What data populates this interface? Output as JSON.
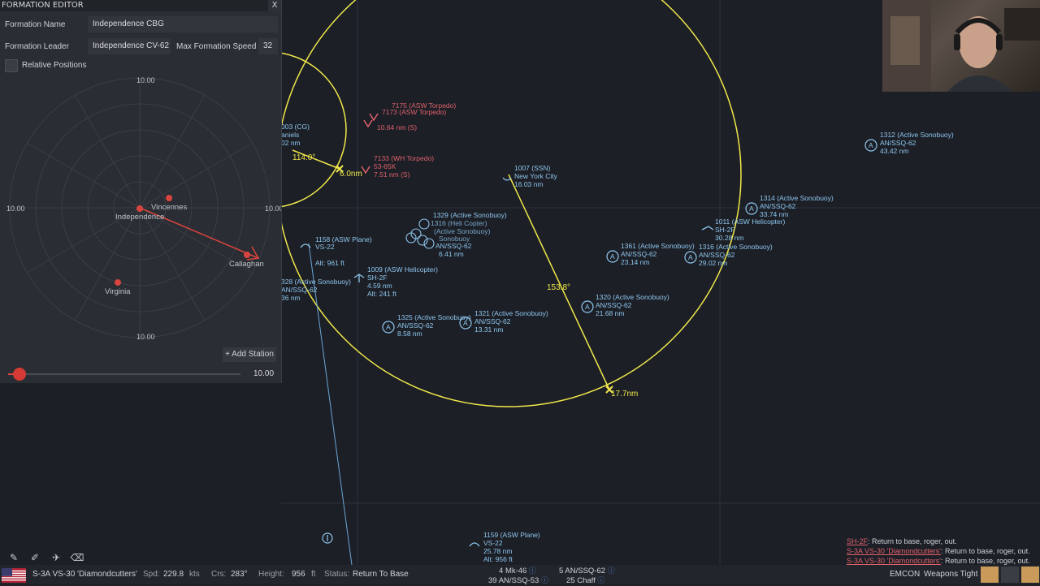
{
  "formation_editor": {
    "title": "FORMATION EDITOR",
    "close_label": "X",
    "name_label": "Formation Name",
    "name_value": "Independence CBG",
    "leader_label": "Formation Leader",
    "leader_value": "Independence CV-62",
    "speed_label": "Max Formation Speed",
    "speed_value": "32",
    "relative_label": "Relative Positions",
    "rings": {
      "top": "10.00",
      "left": "10.00",
      "right": "10.00",
      "bottom": "10.00"
    },
    "units": [
      {
        "name": "Independence"
      },
      {
        "name": "Vincennes"
      },
      {
        "name": "Callaghan"
      },
      {
        "name": "Virginia"
      }
    ],
    "add_station_label": "+ Add Station",
    "slider_value": "10.00",
    "slider_fraction": 0.05
  },
  "map": {
    "labels": {
      "cg1": "003 (CG)",
      "cg2": "aniels",
      "cg3": "02 nm",
      "bear114": "114.0°",
      "rng6": "6.0nm",
      "bear153": "153.8°",
      "rng17": "17.7nm",
      "t1a": "7133 (WH Torpedo)",
      "t1b": "53-65K",
      "t1c": "7.51 nm (S)",
      "t2a": "7175 (ASW Torpedo)",
      "t2b": "7173 (ASW Torpedo)",
      "t2c": "10.64 nm (S)",
      "ssn1": "1007 (SSN)",
      "ssn2": "New York City",
      "ssn3": "16.03 nm",
      "s1312a": "1312 (Active Sonobuoy)",
      "s1312b": "AN/SSQ-62",
      "s1312c": "43.42 nm",
      "s1314a": "1314 (Active Sonobuoy)",
      "s1314b": "AN/SSQ-62",
      "s1314c": "33.74 nm",
      "h1011a": "1011 (ASW Helicopter)",
      "h1011b": "SH-2F",
      "h1011c": "30.28 nm",
      "s1316a": "1316 (Active Sonobuoy)",
      "s1316b": "AN/SSQ-62",
      "s1316c": "29.02 nm",
      "s1361a": "1361 (Active Sonobuoy)",
      "s1361b": "AN/SSQ-62",
      "s1361c": "23.14 nm",
      "s1320a": "1320 (Active Sonobuoy)",
      "s1320b": "AN/SSQ-62",
      "s1320c": "21.68 nm",
      "s1321a": "1321 (Active Sonobuoy)",
      "s1321b": "AN/SSQ-62",
      "s1321c": "13.31 nm",
      "s1325a": "1325 (Active Sonobuoy)",
      "s1325b": "AN/SSQ-62",
      "s1325c": "8.58 nm",
      "h1009a": "1009 (ASW Helicopter)",
      "h1009b": "SH-2F",
      "h1009c": "4.59 nm",
      "h1009d": "Alt: 241 ft",
      "p1158a": "1158 (ASW Plane)",
      "p1158b": "VS-22",
      "p1158c": "Alt: 961 ft",
      "s1328a": "328 (Active Sonobuoy)",
      "s1328b": "AN/SSQ-62",
      "s1328c": "36 nm",
      "cl1": "1329 (Active Sonobuoy)",
      "cl2": "AN/SSQ-62",
      "cl3": "6.41 nm",
      "p1159a": "1159 (ASW Plane)",
      "p1159b": "VS-22",
      "p1159c": "25.78 nm",
      "p1159d": "Alt: 956 ft"
    }
  },
  "messages": [
    {
      "source": "SH-2F",
      "text": ": Return to base, roger, out."
    },
    {
      "source": "S-3A VS-30 'Diamondcutters'",
      "text": ": Return to base, roger, out."
    },
    {
      "source": "S-3A VS-30 'Diamondcutters'",
      "text": ": Return to base, roger, out."
    }
  ],
  "status_bar": {
    "unit_name": "S-3A VS-30 'Diamondcutters'",
    "speed_label": "Spd:",
    "speed_value": "229.8",
    "speed_unit": "kts",
    "course_label": "Crs:",
    "course_value": "283°",
    "height_label": "Height:",
    "height_value": "956",
    "height_unit": "ft",
    "status_label": "Status:",
    "status_value": "Return To Base",
    "weapons": [
      {
        "count": "4",
        "name": "Mk-46"
      },
      {
        "count": "5",
        "name": "AN/SSQ-62"
      },
      {
        "count": "39",
        "name": "AN/SSQ-53"
      },
      {
        "count": "25",
        "name": "Chaff"
      }
    ],
    "emcon_label": "EMCON",
    "weapons_state": "Weapons Tight"
  },
  "colors": {
    "range_ring": "#f0e84a",
    "friendly": "#8ec6ee",
    "hostile": "#e0616c",
    "panel_bg": "#2a2d33",
    "map_bg": "#1c1f26"
  }
}
